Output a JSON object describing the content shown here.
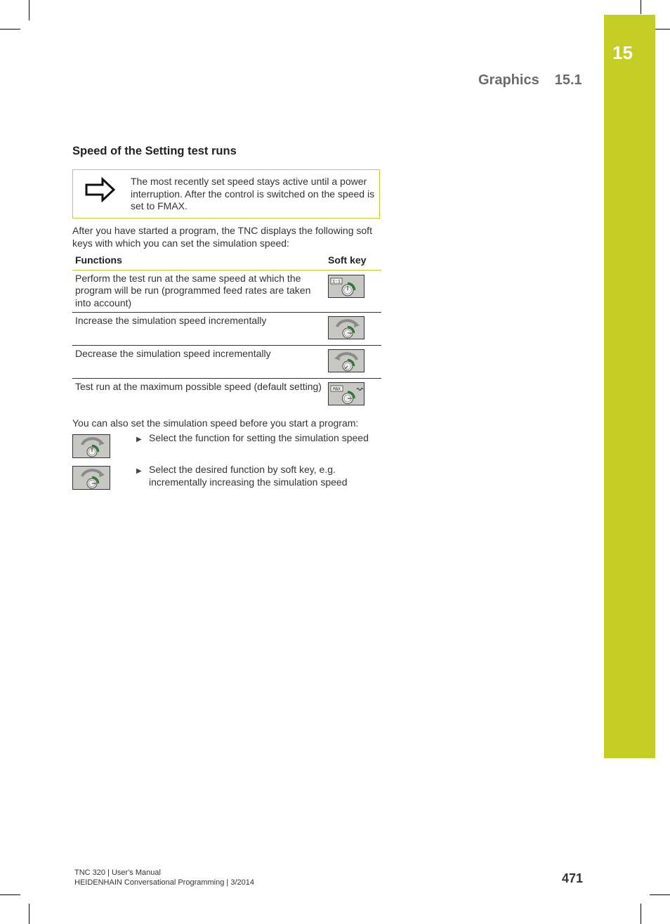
{
  "chapter": {
    "number": "15",
    "tab_color": "#c3cd23"
  },
  "running_head": {
    "title": "Graphics",
    "section": "15.1"
  },
  "section_heading": "Speed of the Setting test runs",
  "note": {
    "icon": "arrow-right-outline-icon",
    "text": "The most recently set speed stays active until a power interruption. After the control is switched on the speed is set to FMAX."
  },
  "intro": "After you have started a program, the TNC displays the following soft keys with which you can set the simulation speed:",
  "table": {
    "headers": [
      "Functions",
      "Soft key"
    ],
    "rows": [
      {
        "function": "Perform the test run at the same speed at which the program will be run (programmed feed rates are taken into account)",
        "softkey_icon": "speed-1-to-1-softkey-icon",
        "softkey_label": "1:1"
      },
      {
        "function": "Increase the simulation speed incrementally",
        "softkey_icon": "speed-increase-softkey-icon"
      },
      {
        "function": "Decrease the simulation speed incrementally",
        "softkey_icon": "speed-decrease-softkey-icon"
      },
      {
        "function": "Test run at the maximum possible speed (default setting)",
        "softkey_icon": "speed-max-softkey-icon",
        "softkey_label": "MAX"
      }
    ]
  },
  "also_text": "You can also set the simulation speed before you start a program:",
  "steps": [
    {
      "softkey_icon": "simulation-speed-softkey-icon",
      "text": "Select the function for setting the simulation speed"
    },
    {
      "softkey_icon": "speed-increase-softkey-icon",
      "text": "Select the desired function by soft key, e.g. incrementally increasing the simulation speed"
    }
  ],
  "footer": {
    "line1": "TNC 320 | User's Manual",
    "line2": "HEIDENHAIN Conversational Programming | 3/2014",
    "page_number": "471"
  },
  "colors": {
    "accent": "#c3cd23",
    "softkey_bg": "#c7c8c4",
    "dial_green": "#1f7a2e"
  }
}
